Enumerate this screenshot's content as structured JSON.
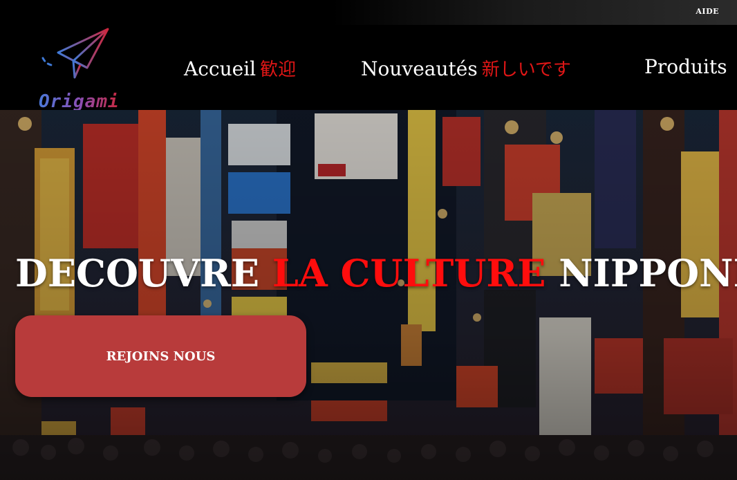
{
  "topbar": {
    "help_link": "AIDE"
  },
  "header": {
    "logo_text": "Origami",
    "nav": [
      {
        "label": "Accueil",
        "jp": "歓迎"
      },
      {
        "label": "Nouveautés",
        "jp": "新しいです"
      },
      {
        "label": "Produits",
        "jp": ""
      }
    ]
  },
  "hero": {
    "title_part1": "DECOUVRE",
    "title_accent": "LA CULTURE",
    "title_part2": "NIPPONE",
    "cta_label": "REJOINS NOUS"
  },
  "colors": {
    "accent_red": "#ff0d0d",
    "cta_background": "#b83b3b",
    "header_background": "#000000"
  }
}
